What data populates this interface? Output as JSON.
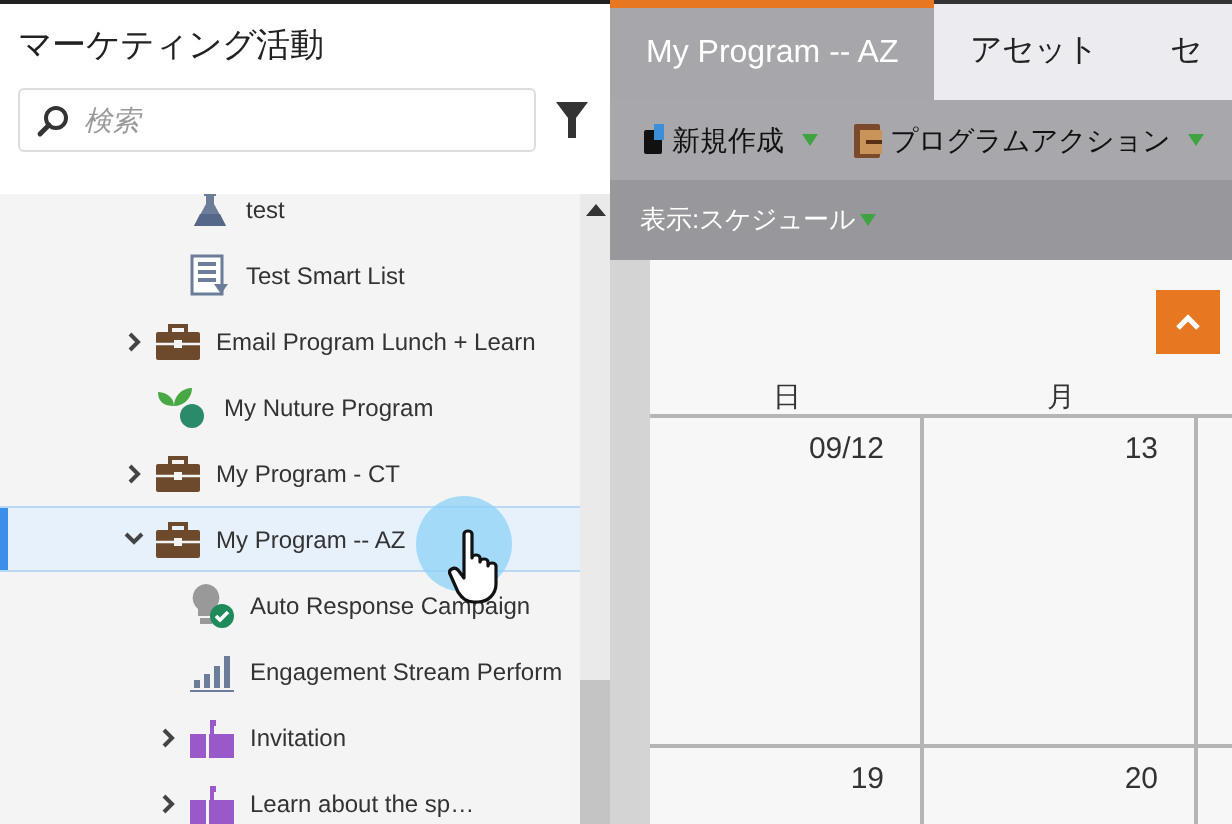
{
  "sidebar": {
    "title": "マーケティング活動",
    "search": {
      "placeholder": "検索"
    },
    "tree": {
      "continued_children": [
        {
          "label": "test",
          "kind": "test",
          "selected": false
        },
        {
          "label": "Test Smart List",
          "kind": "smart-list",
          "selected": false
        }
      ],
      "items": [
        {
          "label": "Email Program Lunch + Learn",
          "kind": "program",
          "selected": false,
          "expanded": false
        },
        {
          "label": "My Nuture Program",
          "kind": "nurture",
          "selected": false
        },
        {
          "label": "My Program - CT",
          "kind": "program",
          "selected": false,
          "expanded": false
        },
        {
          "label": "My Program -- AZ",
          "kind": "program",
          "selected": true,
          "expanded": true,
          "children": [
            {
              "label": "Auto Response Campaign",
              "kind": "campaign",
              "selected": false
            },
            {
              "label": "Engagement Stream Perform",
              "kind": "report",
              "selected": false
            },
            {
              "label": "Invitation",
              "kind": "event",
              "selected": false,
              "expanded": false
            },
            {
              "label": "Learn about the sp…",
              "kind": "event",
              "selected": false,
              "expanded": false
            }
          ]
        }
      ]
    }
  },
  "main": {
    "tabs": [
      {
        "label": "My Program -- AZ",
        "selected": true
      },
      {
        "label": "アセット",
        "selected": false
      },
      {
        "label": "セ",
        "selected": false
      }
    ],
    "toolbar": [
      {
        "label": "新規作成",
        "kind": "new"
      },
      {
        "label": "プログラムアクション",
        "kind": "actions"
      }
    ],
    "view_menu": {
      "label": "表示:スケジュール"
    },
    "calendar": {
      "weekdays": [
        "日",
        "月"
      ],
      "weeks": [
        [
          "09/12",
          "13"
        ],
        [
          "19",
          "20"
        ]
      ]
    }
  }
}
